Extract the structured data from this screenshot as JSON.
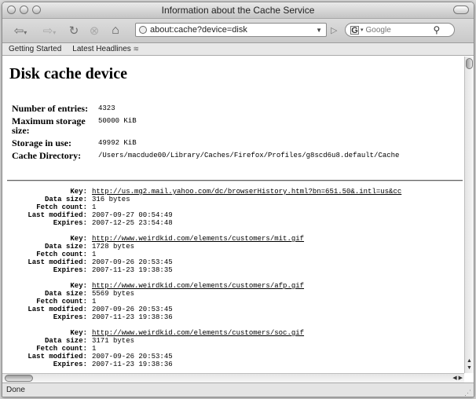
{
  "window": {
    "title": "Information about the Cache Service"
  },
  "toolbar": {
    "back_icon": "back-arrow",
    "forward_icon": "forward-arrow",
    "reload_icon": "reload",
    "stop_icon": "stop",
    "home_icon": "home",
    "url": "about:cache?device=disk",
    "search_placeholder": "Google"
  },
  "bookmarks": [
    {
      "label": "Getting Started"
    },
    {
      "label": "Latest Headlines"
    }
  ],
  "page": {
    "heading": "Disk cache device",
    "summary": [
      {
        "label": "Number of entries:",
        "value": "4323"
      },
      {
        "label": "Maximum storage size:",
        "value": "50000 KiB"
      },
      {
        "label": "Storage in use:",
        "value": "49992 KiB"
      },
      {
        "label": "Cache Directory:",
        "value": "/Users/macdude00/Library/Caches/Firefox/Profiles/g8scd6u8.default/Cache"
      }
    ],
    "entry_labels": {
      "key": "Key:",
      "data_size": "Data size:",
      "fetch_count": "Fetch count:",
      "last_modified": "Last modified:",
      "expires": "Expires:"
    },
    "entries": [
      {
        "key": "http://us.mg2.mail.yahoo.com/dc/browserHistory.html?bn=651.50&.intl=us&cc",
        "data_size": "316 bytes",
        "fetch_count": "1",
        "last_modified": "2007-09-27 00:54:49",
        "expires": "2007-12-25 23:54:48"
      },
      {
        "key": "http://www.weirdkid.com/elements/customers/mit.gif",
        "data_size": "1728 bytes",
        "fetch_count": "1",
        "last_modified": "2007-09-26 20:53:45",
        "expires": "2007-11-23 19:38:35"
      },
      {
        "key": "http://www.weirdkid.com/elements/customers/afp.gif",
        "data_size": "5569 bytes",
        "fetch_count": "1",
        "last_modified": "2007-09-26 20:53:45",
        "expires": "2007-11-23 19:38:36"
      },
      {
        "key": "http://www.weirdkid.com/elements/customers/soc.gif",
        "data_size": "3171 bytes",
        "fetch_count": "1",
        "last_modified": "2007-09-26 20:53:45",
        "expires": "2007-11-23 19:38:36"
      }
    ]
  },
  "status": {
    "text": "Done"
  }
}
